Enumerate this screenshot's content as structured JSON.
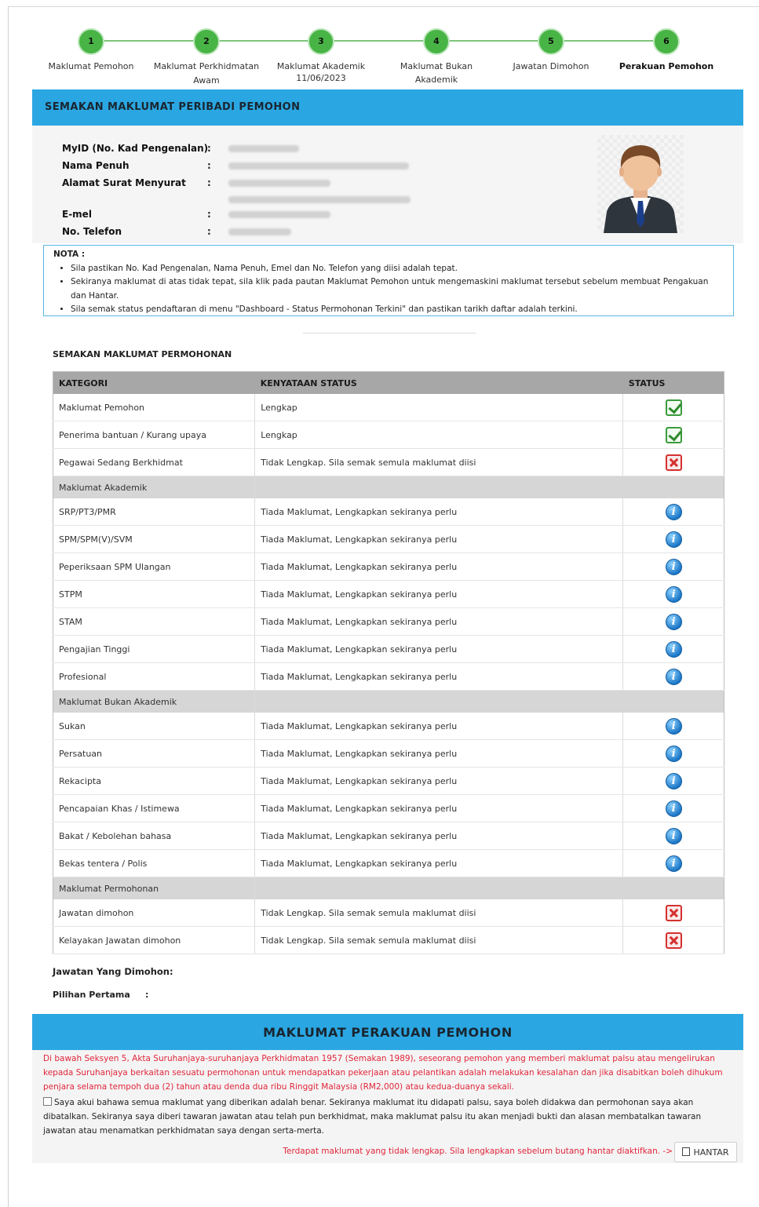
{
  "stepper": {
    "steps": [
      {
        "num": "1",
        "label": "Maklumat Pemohon",
        "date": ""
      },
      {
        "num": "2",
        "label": "Maklumat Perkhidmatan Awam",
        "date": ""
      },
      {
        "num": "3",
        "label": "Maklumat Akademik",
        "date": "11/06/2023"
      },
      {
        "num": "4",
        "label": "Maklumat Bukan Akademik",
        "date": ""
      },
      {
        "num": "5",
        "label": "Jawatan Dimohon",
        "date": ""
      },
      {
        "num": "6",
        "label": "Perakuan Pemohon",
        "date": ""
      }
    ]
  },
  "personal": {
    "title": "SEMAKAN MAKLUMAT PERIBADI PEMOHON",
    "fields": [
      {
        "label": "MyID (No. Kad Pengenalan)",
        "colon": ":"
      },
      {
        "label": "Nama Penuh",
        "colon": ":"
      },
      {
        "label": "Alamat Surat Menyurat",
        "colon": ":"
      },
      {
        "label": "E-mel",
        "colon": ":"
      },
      {
        "label": "No. Telefon",
        "colon": ":"
      }
    ]
  },
  "nota": {
    "title": "NOTA :",
    "items": [
      "Sila pastikan No. Kad Pengenalan, Nama Penuh, Emel dan No. Telefon yang diisi adalah tepat.",
      "Sekiranya maklumat di atas tidak tepat, sila klik pada pautan Maklumat Pemohon untuk mengemaskini maklumat tersebut sebelum membuat Pengakuan dan Hantar.",
      "Sila semak status pendaftaran di menu \"Dashboard - Status Permohonan Terkini\" dan pastikan tarikh daftar adalah terkini."
    ]
  },
  "application": {
    "title": "SEMAKAN MAKLUMAT PERMOHONAN",
    "columns": [
      "KATEGORI",
      "KENYATAAN STATUS",
      "STATUS"
    ],
    "rows": [
      {
        "kategori": "Maklumat Pemohon",
        "kenyataan": "Lengkap",
        "status": "ok"
      },
      {
        "kategori": "Penerima bantuan / Kurang upaya",
        "kenyataan": "Lengkap",
        "status": "ok"
      },
      {
        "kategori": "Pegawai Sedang Berkhidmat",
        "kenyataan": "Tidak Lengkap. Sila semak semula maklumat diisi",
        "status": "x"
      },
      {
        "group": "Maklumat Akademik"
      },
      {
        "kategori": "SRP/PT3/PMR",
        "kenyataan": "Tiada Maklumat, Lengkapkan sekiranya perlu",
        "status": "info"
      },
      {
        "kategori": "SPM/SPM(V)/SVM",
        "kenyataan": "Tiada Maklumat, Lengkapkan sekiranya perlu",
        "status": "info"
      },
      {
        "kategori": "Peperiksaan SPM Ulangan",
        "kenyataan": "Tiada Maklumat, Lengkapkan sekiranya perlu",
        "status": "info"
      },
      {
        "kategori": "STPM",
        "kenyataan": "Tiada Maklumat, Lengkapkan sekiranya perlu",
        "status": "info"
      },
      {
        "kategori": "STAM",
        "kenyataan": "Tiada Maklumat, Lengkapkan sekiranya perlu",
        "status": "info"
      },
      {
        "kategori": "Pengajian Tinggi",
        "kenyataan": "Tiada Maklumat, Lengkapkan sekiranya perlu",
        "status": "info"
      },
      {
        "kategori": "Profesional",
        "kenyataan": "Tiada Maklumat, Lengkapkan sekiranya perlu",
        "status": "info"
      },
      {
        "group": "Maklumat Bukan Akademik"
      },
      {
        "kategori": "Sukan",
        "kenyataan": "Tiada Maklumat, Lengkapkan sekiranya perlu",
        "status": "info"
      },
      {
        "kategori": "Persatuan",
        "kenyataan": "Tiada Maklumat, Lengkapkan sekiranya perlu",
        "status": "info"
      },
      {
        "kategori": "Rekacipta",
        "kenyataan": "Tiada Maklumat, Lengkapkan sekiranya perlu",
        "status": "info"
      },
      {
        "kategori": "Pencapaian Khas / Istimewa",
        "kenyataan": "Tiada Maklumat, Lengkapkan sekiranya perlu",
        "status": "info"
      },
      {
        "kategori": "Bakat / Kebolehan bahasa",
        "kenyataan": "Tiada Maklumat, Lengkapkan sekiranya perlu",
        "status": "info"
      },
      {
        "kategori": "Bekas tentera / Polis",
        "kenyataan": "Tiada Maklumat, Lengkapkan sekiranya perlu",
        "status": "info"
      },
      {
        "group": "Maklumat Permohonan"
      },
      {
        "kategori": "Jawatan dimohon",
        "kenyataan": "Tidak Lengkap. Sila semak semula maklumat diisi",
        "status": "x"
      },
      {
        "kategori": "Kelayakan Jawatan dimohon",
        "kenyataan": "Tidak Lengkap. Sila semak semula maklumat diisi",
        "status": "x"
      }
    ]
  },
  "jawatan": {
    "title": "Jawatan Yang Dimohon:",
    "pilihan_label": "Pilihan Pertama",
    "colon": ":"
  },
  "declaration": {
    "title": "MAKLUMAT PERAKUAN PEMOHON",
    "warning": "Di bawah Seksyen 5, Akta Suruhanjaya-suruhanjaya Perkhidmatan 1957 (Semakan 1989), seseorang pemohon yang memberi maklumat palsu atau mengelirukan kepada Suruhanjaya berkaitan sesuatu permohonan untuk mendapatkan pekerjaan atau pelantikan adalah melakukan kesalahan dan jika disabitkan boleh dihukum penjara selama tempoh dua (2) tahun atau denda dua ribu Ringgit Malaysia (RM2,000) atau kedua-duanya sekali.",
    "acknowledge": "Saya akui bahawa semua maklumat yang diberikan adalah benar. Sekiranya maklumat itu didapati palsu, saya boleh didakwa dan permohonan saya akan dibatalkan. Sekiranya saya diberi tawaran jawatan atau telah pun berkhidmat, maka maklumat palsu itu akan menjadi bukti dan alasan membatalkan tawaran jawatan atau menamatkan perkhidmatan saya dengan serta-merta.",
    "incomplete_msg": "Terdapat maklumat yang tidak lengkap. Sila lengkapkan sebelum butang hantar diaktifkan. ->",
    "submit_label": "HANTAR"
  },
  "colors": {
    "step_green": "#48b445",
    "header_blue": "#2aa7e2",
    "error_red": "#e1263a",
    "table_header_gray": "#a7a7a7"
  },
  "icons": {
    "complete": "check-icon",
    "incomplete": "cross-icon",
    "info": "info-icon",
    "submit": "save-icon"
  }
}
